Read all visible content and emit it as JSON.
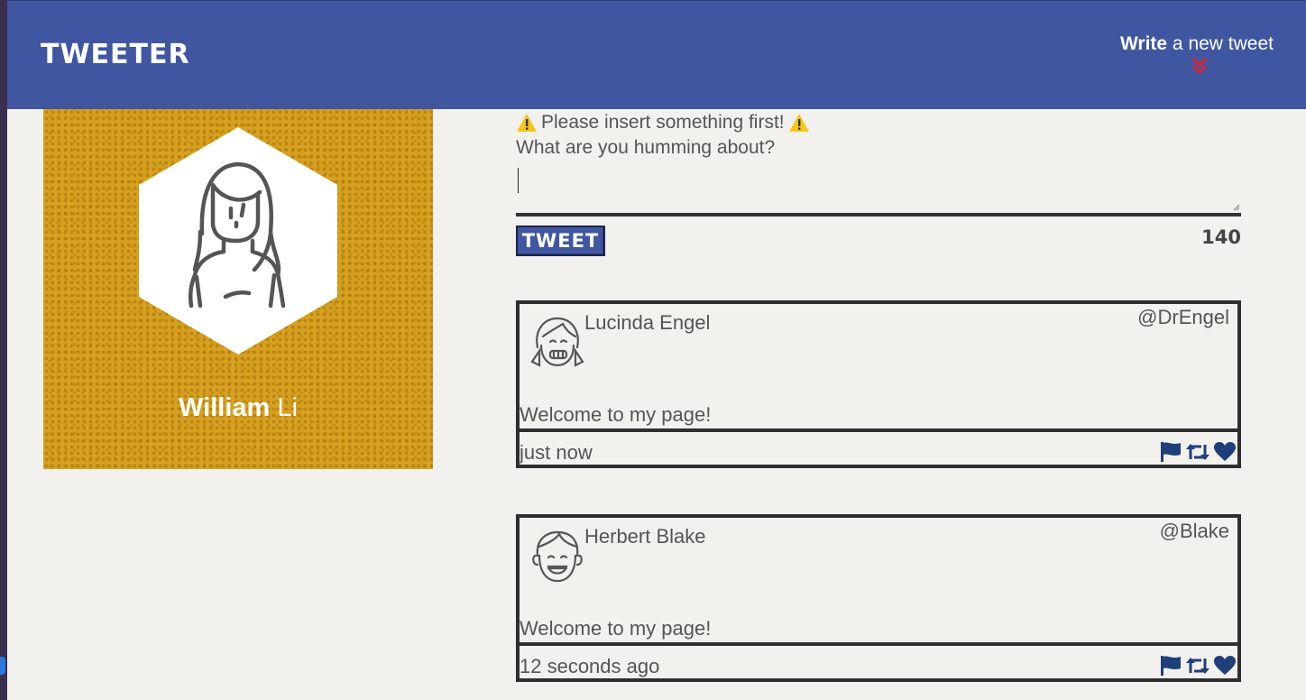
{
  "nav": {
    "brand": "TWEETER",
    "compose_bold": "Write",
    "compose_rest": " a new tweet",
    "compose_icon": "chevron-double-down-icon"
  },
  "profile": {
    "first_name": "William",
    "last_name": " Li",
    "background_color": "#d7a11f"
  },
  "composer": {
    "error": "Please insert something first!",
    "warning_icon": "warning-icon",
    "prompt": "What are you humming about?",
    "input_value": "",
    "button_label": "TWEET",
    "counter": "140"
  },
  "tweets": [
    {
      "name": "Lucinda Engel",
      "handle": "@DrEngel",
      "body": "Welcome to my page!",
      "time": "just now",
      "avatar_icon": "girl-avatar-icon"
    },
    {
      "name": "Herbert Blake",
      "handle": "@Blake",
      "body": "Welcome to my page!",
      "time": "12 seconds ago",
      "avatar_icon": "boy-avatar-icon"
    }
  ],
  "actions": [
    "flag-icon",
    "retweet-icon",
    "heart-icon"
  ],
  "colors": {
    "nav": "#4056a1",
    "background": "#f3f1ed",
    "action_icons": "#1f3f7a",
    "chevron": "#e0202a"
  }
}
